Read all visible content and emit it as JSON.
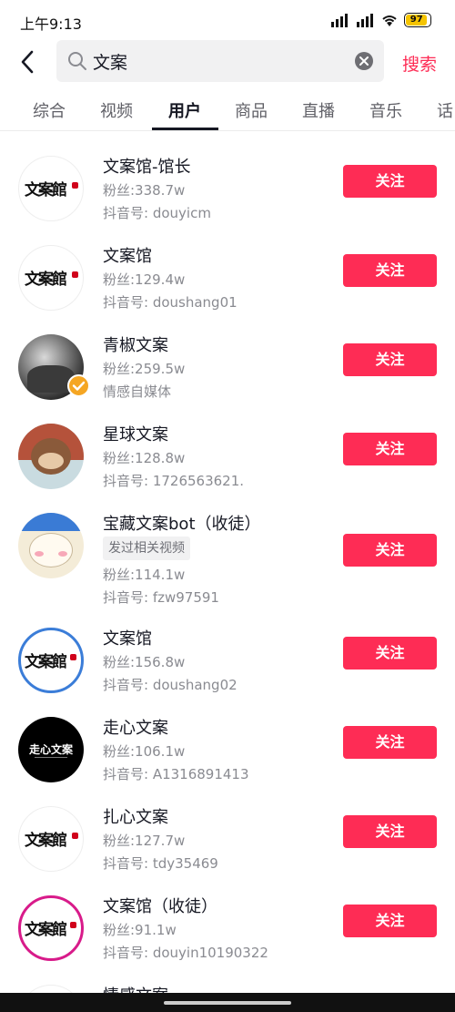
{
  "status_bar": {
    "time": "上午9:13",
    "battery": "97"
  },
  "search": {
    "query": "文案",
    "submit_label": "搜索"
  },
  "tabs": [
    {
      "label": "综合"
    },
    {
      "label": "视频"
    },
    {
      "label": "用户"
    },
    {
      "label": "商品"
    },
    {
      "label": "直播"
    },
    {
      "label": "音乐"
    },
    {
      "label": "话"
    }
  ],
  "users": [
    {
      "name": "文案馆-馆长",
      "fans": "粉丝:338.7w",
      "sub": "抖音号: douyicm",
      "follow": "关注",
      "avatar_text": "文案館"
    },
    {
      "name": "文案馆",
      "fans": "粉丝:129.4w",
      "sub": "抖音号: doushang01",
      "follow": "关注",
      "avatar_text": "文案館"
    },
    {
      "name": "青椒文案",
      "fans": "粉丝:259.5w",
      "sub": "情感自媒体",
      "follow": "关注"
    },
    {
      "name": "星球文案",
      "fans": "粉丝:128.8w",
      "sub": "抖音号: 1726563621.",
      "follow": "关注"
    },
    {
      "name": "宝藏文案bot（收徒）",
      "tag": "发过相关视频",
      "fans": "粉丝:114.1w",
      "sub": "抖音号: fzw97591",
      "follow": "关注"
    },
    {
      "name": "文案馆",
      "fans": "粉丝:156.8w",
      "sub": "抖音号: doushang02",
      "follow": "关注",
      "avatar_text": "文案館"
    },
    {
      "name": "走心文案",
      "fans": "粉丝:106.1w",
      "sub": "抖音号: A1316891413",
      "follow": "关注",
      "avatar_text": "走心文案"
    },
    {
      "name": "扎心文案",
      "fans": "粉丝:127.7w",
      "sub": "抖音号: tdy35469",
      "follow": "关注",
      "avatar_text": "文案館"
    },
    {
      "name": "文案馆（收徒）",
      "fans": "粉丝:91.1w",
      "sub": "抖音号: douyin10190322",
      "follow": "关注",
      "avatar_text": "文案館"
    },
    {
      "name": "情感文案"
    }
  ],
  "colors": {
    "accent": "#fe2c55",
    "badge": "#f5a623"
  }
}
